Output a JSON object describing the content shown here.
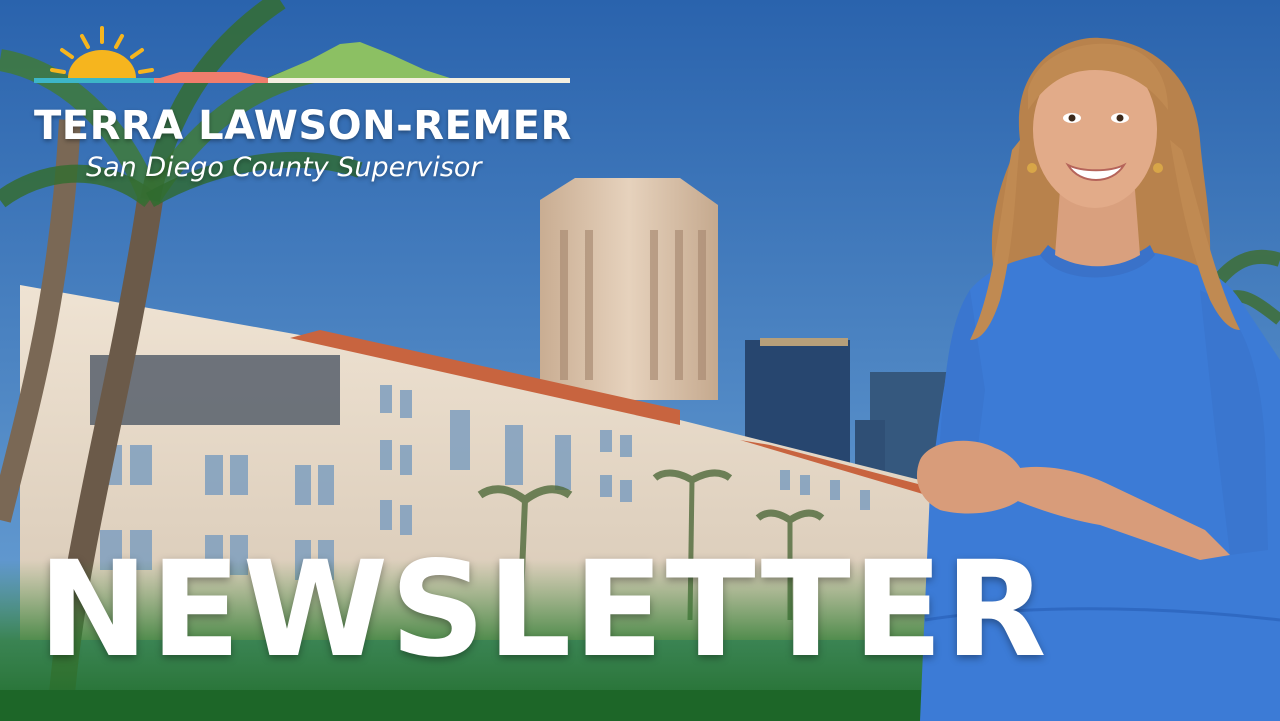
{
  "branding": {
    "name": "TERRA LAWSON-REMER",
    "title": "San Diego County Supervisor"
  },
  "headline": "NEWSLETTER",
  "colors": {
    "sky": "#2f6fb5",
    "sun": "#f6b51e",
    "mountain": "#8cc063",
    "coral": "#f07d6c",
    "teal": "#3db6c8",
    "dress": "#3c7bd6",
    "grass": "#2e7d32"
  },
  "icons": [
    "sun-icon",
    "mountain-icon"
  ]
}
